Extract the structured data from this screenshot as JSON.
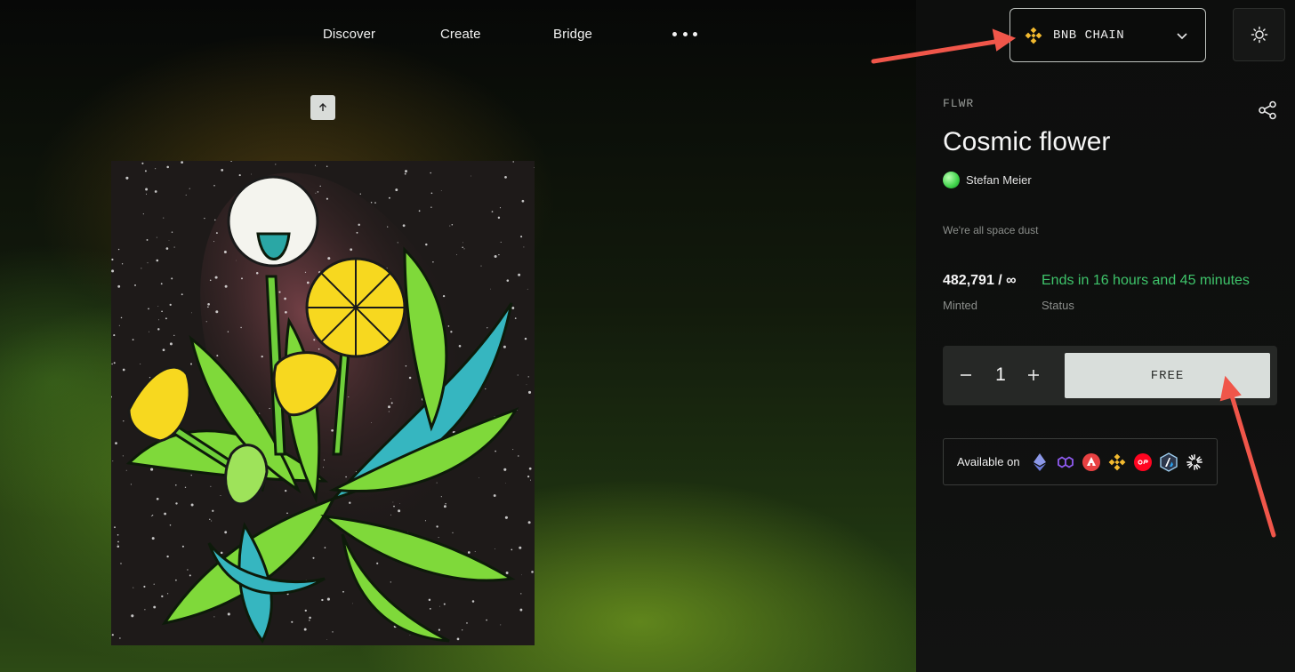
{
  "nav": {
    "items": [
      {
        "label": "Discover"
      },
      {
        "label": "Create"
      },
      {
        "label": "Bridge"
      }
    ],
    "more_icon": "more-horizontal-icon"
  },
  "chain_selector": {
    "label": "BNB CHAIN",
    "icon": "bnb-icon",
    "icon_color": "#F3BA2F"
  },
  "theme_toggle": {
    "icon": "sun-icon"
  },
  "scroll_up": {
    "icon": "arrow-up-icon"
  },
  "artwork": {
    "alt": "Cosmic flower"
  },
  "collection": {
    "symbol": "FLWR",
    "title": "Cosmic flower",
    "creator": "Stefan Meier",
    "description": "We're all space dust"
  },
  "stats": {
    "minted_value": "482,791 / ∞",
    "minted_label": "Minted",
    "status_value": "Ends in 16 hours and 45 minutes",
    "status_label": "Status",
    "status_color": "#3EC46A"
  },
  "mint": {
    "quantity": "1",
    "button_label": "FREE"
  },
  "availability": {
    "label": "Available on",
    "networks": [
      "ethereum-icon",
      "polygon-icon",
      "avalanche-icon",
      "bnb-icon",
      "optimism-icon",
      "arbitrum-icon",
      "zora-icon"
    ]
  },
  "colors": {
    "accent_green": "#3EC46A",
    "annotation_arrow": "#F0564A",
    "button_bg": "#D9DEDB"
  }
}
